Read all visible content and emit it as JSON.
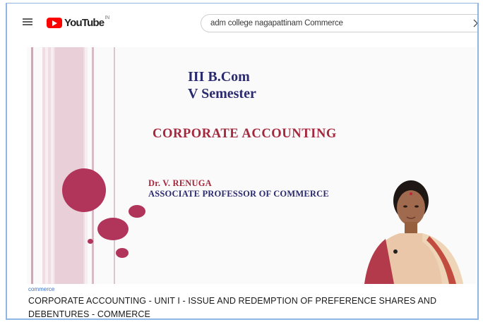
{
  "header": {
    "logo_text": "YouTube",
    "logo_region": "IN",
    "search_query": "adm college nagapattinam Commerce"
  },
  "slide": {
    "title_line1": "III B.Com",
    "title_line2": "V Semester",
    "subject": "CORPORATE ACCOUNTING",
    "author": "Dr. V. RENUGA",
    "role": "ASSOCIATE PROFESSOR OF COMMERCE",
    "accent_color": "#b1345a",
    "heading_color": "#2a2a6e"
  },
  "video": {
    "channel": "commerce",
    "title": "CORPORATE ACCOUNTING - UNIT I - ISSUE AND REDEMPTION OF PREFERENCE SHARES AND DEBENTURES - COMMERCE"
  },
  "icons": [
    "menu-icon",
    "youtube-logo-icon",
    "clear-search-icon"
  ]
}
